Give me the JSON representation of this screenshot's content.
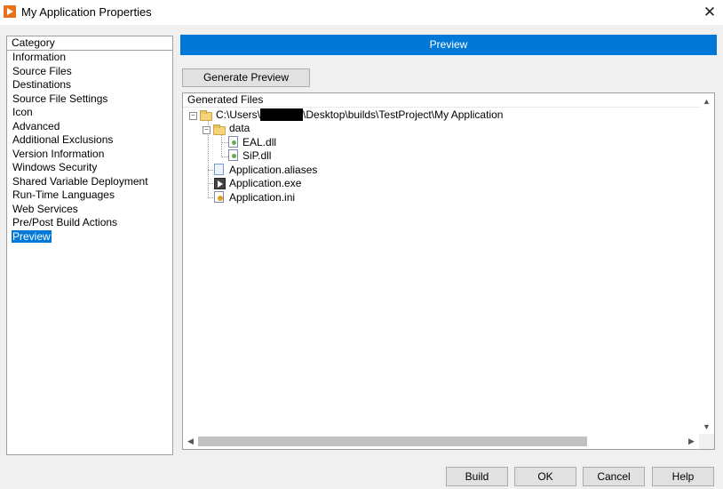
{
  "window": {
    "title": "My Application Properties",
    "close_glyph": "✕"
  },
  "category": {
    "header": "Category",
    "items": [
      "Information",
      "Source Files",
      "Destinations",
      "Source File Settings",
      "Icon",
      "Advanced",
      "Additional Exclusions",
      "Version Information",
      "Windows Security",
      "Shared Variable Deployment",
      "Run-Time Languages",
      "Web Services",
      "Pre/Post Build Actions",
      "Preview"
    ],
    "selected": "Preview"
  },
  "preview": {
    "section_title": "Preview",
    "generate_button": "Generate Preview",
    "files_header": "Generated Files",
    "tree": {
      "root_prefix": "C:\\Users\\",
      "root_suffix": "\\Desktop\\builds\\TestProject\\My Application",
      "data_folder": "data",
      "eal_dll": "EAL.dll",
      "sip_dll": "SiP.dll",
      "app_aliases": "Application.aliases",
      "app_exe": "Application.exe",
      "app_ini": "Application.ini"
    },
    "scroll_up": "▲",
    "scroll_down": "▼",
    "scroll_left": "◀",
    "scroll_right": "▶"
  },
  "buttons": {
    "build": "Build",
    "ok": "OK",
    "cancel": "Cancel",
    "help": "Help"
  },
  "colors": {
    "accent": "#0078d7",
    "icon_orange": "#e8721c"
  }
}
